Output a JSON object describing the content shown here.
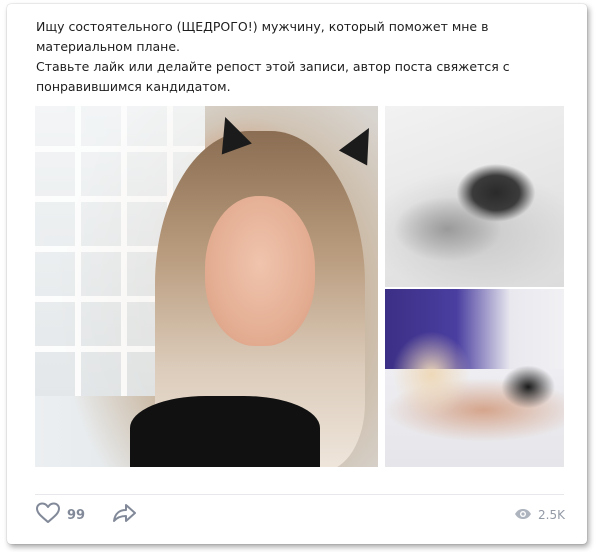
{
  "post": {
    "text_line1": "Ищу состоятельного (ЩЕДРОГО!) мужчину, который поможет мне в материальном плане.",
    "text_line2": "Ставьте лайк или делайте репост этой записи, автор поста свяжется с понравившимся кандидатом."
  },
  "photos": [
    {
      "description_icon": "photo-main"
    },
    {
      "description_icon": "photo-top-right"
    },
    {
      "description_icon": "photo-bottom-right"
    }
  ],
  "actions": {
    "like_icon": "heart-icon",
    "like_count": "99",
    "share_icon": "share-arrow-icon",
    "views_icon": "eye-icon",
    "views_count": "2.5K"
  },
  "colors": {
    "text": "#1e1e1e",
    "action_gray": "#828a99",
    "divider": "#e7e8ec"
  }
}
